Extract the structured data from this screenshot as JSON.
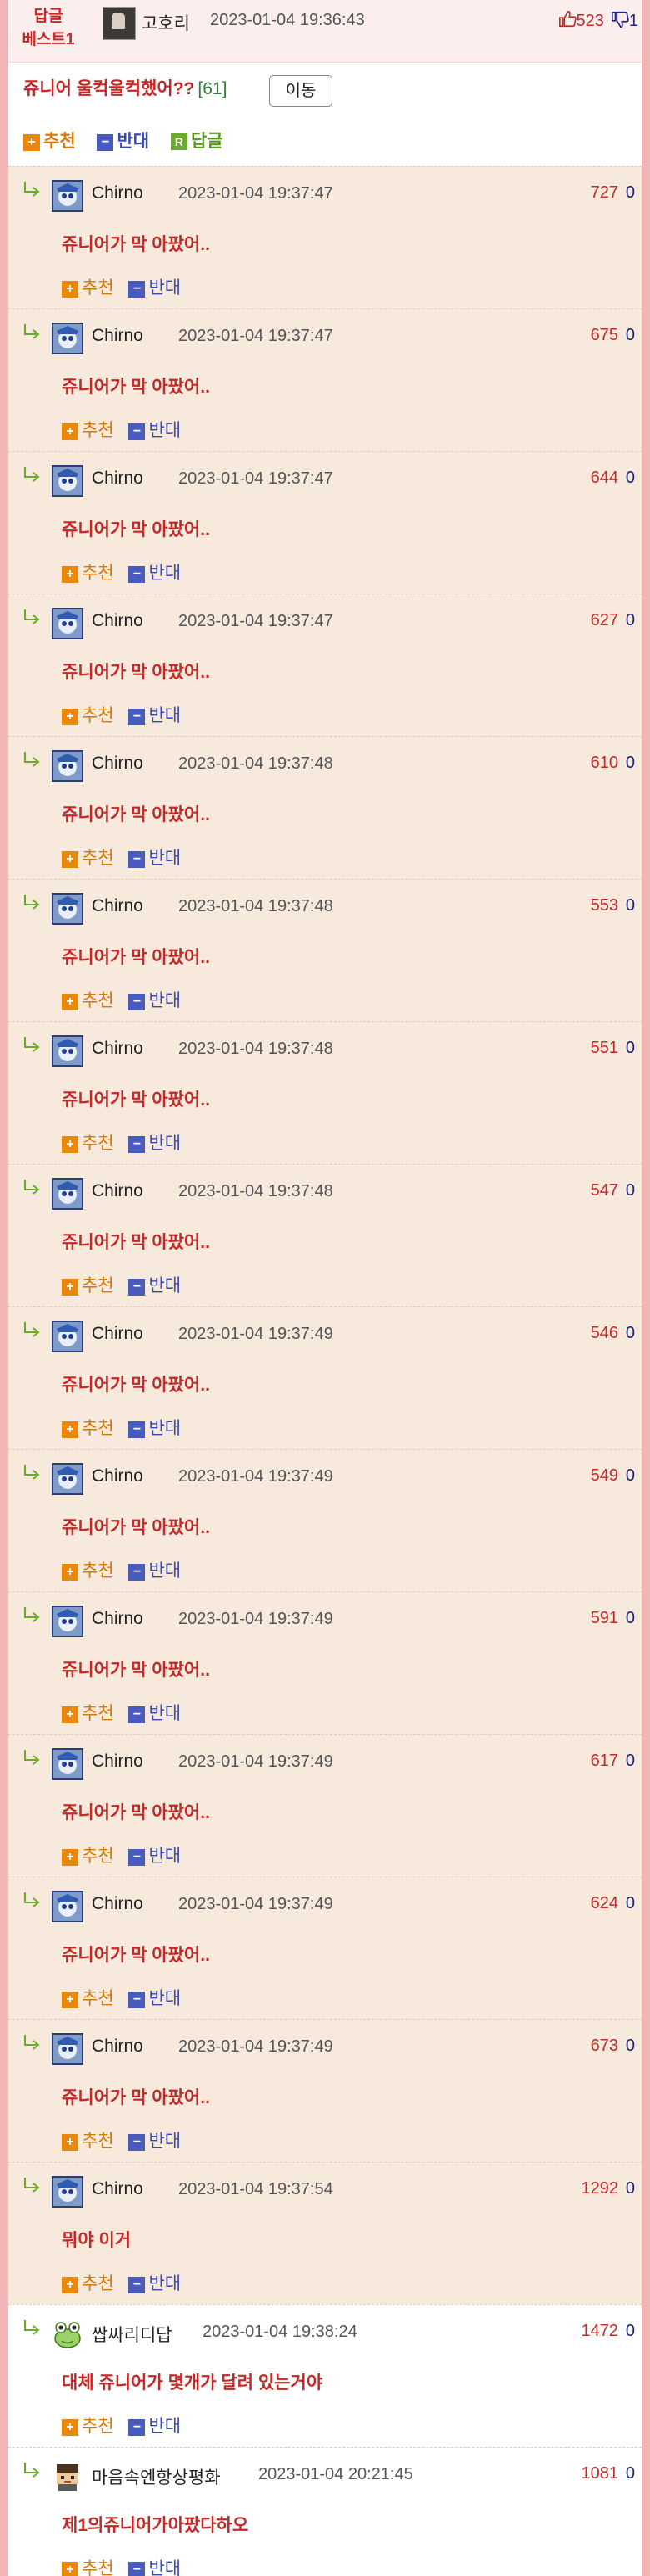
{
  "header": {
    "best_label_line1": "답글",
    "best_label_line2": "베스트1",
    "author": "고호리",
    "date": "2023-01-04 19:36:43",
    "up": "523",
    "down": "1"
  },
  "post": {
    "title": "쥬니어 울컥울컥했어??",
    "comment_count": "[61]",
    "move_label": "이동"
  },
  "actions": {
    "recommend": "추천",
    "oppose": "반대",
    "reply": "답글"
  },
  "comments": [
    {
      "name": "Chirno",
      "date": "2023-01-04 19:37:47",
      "up": "727",
      "down": "0",
      "text": "쥬니어가 막 아팠어..",
      "avatar": "blue-character-avatar",
      "bg": "tan"
    },
    {
      "name": "Chirno",
      "date": "2023-01-04 19:37:47",
      "up": "675",
      "down": "0",
      "text": "쥬니어가 막 아팠어..",
      "avatar": "blue-character-avatar",
      "bg": "tan"
    },
    {
      "name": "Chirno",
      "date": "2023-01-04 19:37:47",
      "up": "644",
      "down": "0",
      "text": "쥬니어가 막 아팠어..",
      "avatar": "blue-character-avatar",
      "bg": "tan"
    },
    {
      "name": "Chirno",
      "date": "2023-01-04 19:37:47",
      "up": "627",
      "down": "0",
      "text": "쥬니어가 막 아팠어..",
      "avatar": "blue-character-avatar",
      "bg": "tan"
    },
    {
      "name": "Chirno",
      "date": "2023-01-04 19:37:48",
      "up": "610",
      "down": "0",
      "text": "쥬니어가 막 아팠어..",
      "avatar": "blue-character-avatar",
      "bg": "tan"
    },
    {
      "name": "Chirno",
      "date": "2023-01-04 19:37:48",
      "up": "553",
      "down": "0",
      "text": "쥬니어가 막 아팠어..",
      "avatar": "blue-character-avatar",
      "bg": "tan"
    },
    {
      "name": "Chirno",
      "date": "2023-01-04 19:37:48",
      "up": "551",
      "down": "0",
      "text": "쥬니어가 막 아팠어..",
      "avatar": "blue-character-avatar",
      "bg": "tan"
    },
    {
      "name": "Chirno",
      "date": "2023-01-04 19:37:48",
      "up": "547",
      "down": "0",
      "text": "쥬니어가 막 아팠어..",
      "avatar": "blue-character-avatar",
      "bg": "tan"
    },
    {
      "name": "Chirno",
      "date": "2023-01-04 19:37:49",
      "up": "546",
      "down": "0",
      "text": "쥬니어가 막 아팠어..",
      "avatar": "blue-character-avatar",
      "bg": "tan"
    },
    {
      "name": "Chirno",
      "date": "2023-01-04 19:37:49",
      "up": "549",
      "down": "0",
      "text": "쥬니어가 막 아팠어..",
      "avatar": "blue-character-avatar",
      "bg": "tan"
    },
    {
      "name": "Chirno",
      "date": "2023-01-04 19:37:49",
      "up": "591",
      "down": "0",
      "text": "쥬니어가 막 아팠어..",
      "avatar": "blue-character-avatar",
      "bg": "tan"
    },
    {
      "name": "Chirno",
      "date": "2023-01-04 19:37:49",
      "up": "617",
      "down": "0",
      "text": "쥬니어가 막 아팠어..",
      "avatar": "blue-character-avatar",
      "bg": "tan"
    },
    {
      "name": "Chirno",
      "date": "2023-01-04 19:37:49",
      "up": "624",
      "down": "0",
      "text": "쥬니어가 막 아팠어..",
      "avatar": "blue-character-avatar",
      "bg": "tan"
    },
    {
      "name": "Chirno",
      "date": "2023-01-04 19:37:49",
      "up": "673",
      "down": "0",
      "text": "쥬니어가 막 아팠어..",
      "avatar": "blue-character-avatar",
      "bg": "tan"
    },
    {
      "name": "Chirno",
      "date": "2023-01-04 19:37:54",
      "up": "1292",
      "down": "0",
      "text": "뭐야 이거",
      "avatar": "blue-character-avatar",
      "bg": "tan"
    },
    {
      "name": "쌉싸리디답",
      "date": "2023-01-04 19:38:24",
      "up": "1472",
      "down": "0",
      "text": "대체 쥬니어가 몇개가 달려 있는거야",
      "avatar": "frog-avatar",
      "bg": "white"
    },
    {
      "name": "마음속엔항상평화",
      "date": "2023-01-04 20:21:45",
      "up": "1081",
      "down": "0",
      "text": "제1의쥬니어가아팠다하오",
      "avatar": "pixel-person-avatar",
      "bg": "white"
    }
  ],
  "colors": {
    "accent_red": "#c62828",
    "down_blue": "#1a237e",
    "recommend_orange": "#e8890c",
    "oppose_blue": "#4a5bbf",
    "reply_green": "#6aab2b",
    "comment_bg": "#f7e9dc",
    "side_pink": "#f2b5b5"
  }
}
